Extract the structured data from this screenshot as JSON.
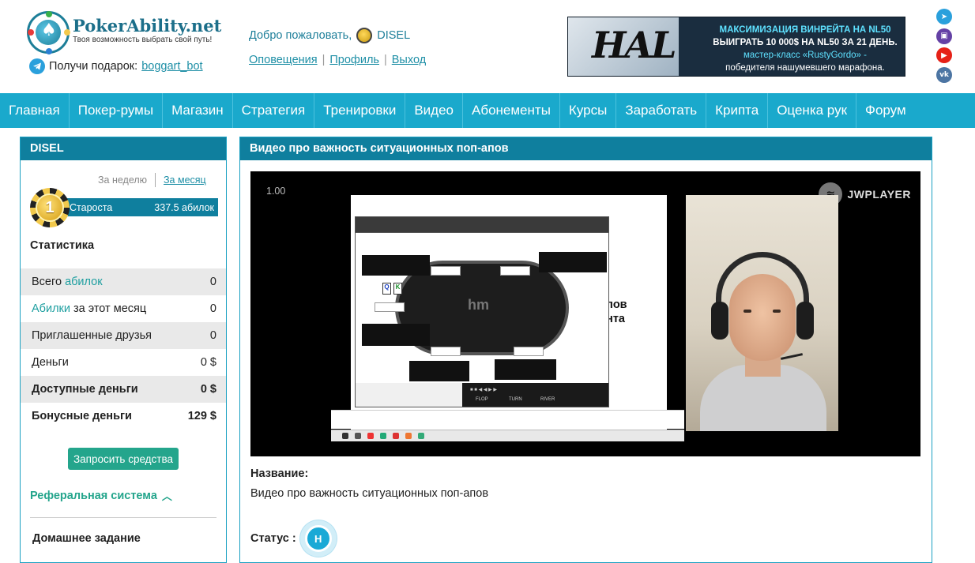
{
  "header": {
    "logo_name": "PokerAbility",
    "logo_tld": ".net",
    "logo_tagline": "Твоя возможность выбрать свой путь!",
    "gift_text": "Получи подарок:",
    "gift_link": "boggart_bot",
    "welcome_text": "Добро пожаловать,",
    "username": "DISEL",
    "links": [
      "Оповещения",
      "Профиль",
      "Выход"
    ],
    "banner": {
      "logo_text": "HAL",
      "line1": "МАКСИМИЗАЦИЯ ВИНРЕЙТА НА NL50",
      "line2": "ВЫИГРАТЬ 10 000$ НА NL50 ЗА 21 ДЕНЬ.",
      "line3": "мастер-класс «RustyGordo» -",
      "line4": "победителя нашумевшего марафона."
    },
    "socials": [
      {
        "icon": "telegram-icon",
        "color": "#2aa0dc",
        "glyph": "➤"
      },
      {
        "icon": "twitch-icon",
        "color": "#6441a5",
        "glyph": "▣"
      },
      {
        "icon": "youtube-icon",
        "color": "#e62117",
        "glyph": "▶"
      },
      {
        "icon": "vk-icon",
        "color": "#4c75a3",
        "glyph": "vk"
      }
    ]
  },
  "nav": [
    "Главная",
    "Покер-румы",
    "Магазин",
    "Стратегия",
    "Тренировки",
    "Видео",
    "Абонементы",
    "Курсы",
    "Заработать",
    "Крипта",
    "Оценка рук",
    "Форум"
  ],
  "sidebar": {
    "title": "DISEL",
    "period_week": "За неделю",
    "period_month": "За месяц",
    "rank_number": "1",
    "rank_label": "Староста",
    "rank_value": "337.5 абилок",
    "stats_title": "Статистика",
    "stats": [
      {
        "pre": "Всего ",
        "hl": "абилок",
        "post": "",
        "value": "0",
        "alt": true,
        "bold": false
      },
      {
        "pre": "",
        "hl": "Абилки",
        "post": " за этот месяц",
        "value": "0",
        "alt": false,
        "bold": false
      },
      {
        "pre": "Приглашенные друзья",
        "hl": "",
        "post": "",
        "value": "0",
        "alt": true,
        "bold": false
      },
      {
        "pre": "Деньги",
        "hl": "",
        "post": "",
        "value": "0 $",
        "alt": false,
        "bold": false
      },
      {
        "pre": "Доступные деньги",
        "hl": "",
        "post": "",
        "value": "0 $",
        "alt": true,
        "bold": true
      },
      {
        "pre": "Бонусные деньги",
        "hl": "",
        "post": "",
        "value": "129 $",
        "alt": false,
        "bold": true
      }
    ],
    "request_button": "Запросить средства",
    "referral": "Реферальная система",
    "homework": "Домашнее задание"
  },
  "main": {
    "title": "Видео про важность ситуационных поп-апов",
    "player": {
      "speed": "1.00",
      "brand": "JWPLAYER",
      "slide_text_1": "апов",
      "slide_text_2": "ента",
      "controls": [
        "FLOP",
        "TURN",
        "RIVER"
      ],
      "table_logo": "hm"
    },
    "name_label": "Название:",
    "name_value": "Видео про важность ситуационных поп-апов",
    "status_label": "Статус :",
    "status_badge": "Н"
  }
}
